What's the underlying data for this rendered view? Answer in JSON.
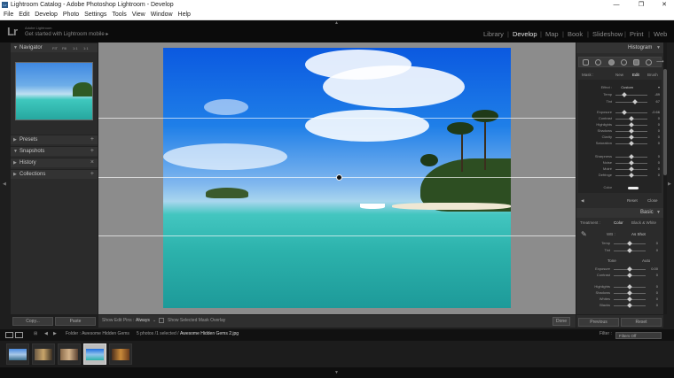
{
  "window": {
    "title": "Lightroom Catalog - Adobe Photoshop Lightroom - Develop",
    "app_icon": "Lr"
  },
  "menu": [
    "File",
    "Edit",
    "Develop",
    "Photo",
    "Settings",
    "Tools",
    "View",
    "Window",
    "Help"
  ],
  "identity": {
    "logo": "Lr",
    "brand_small": "Adobe Lightroom",
    "brand": "Get started with Lightroom mobile ▸"
  },
  "modules": [
    "Library",
    "Develop",
    "Map",
    "Book",
    "Slideshow",
    "Print",
    "Web"
  ],
  "active_module": "Develop",
  "left": {
    "navigator": {
      "title": "Navigator",
      "options": [
        "FIT",
        "Fill",
        "1:1",
        "1:1"
      ]
    },
    "panels": [
      "Presets",
      "Snapshots",
      "History",
      "Collections"
    ],
    "copy_label": "Copy...",
    "paste_label": "Paste"
  },
  "toolbar": {
    "overlay_label": "Show Edit Pins :",
    "overlay_value": "Always",
    "mask_label": "Show Selected Mask Overlay",
    "done_label": "Done"
  },
  "right": {
    "histogram_title": "Histogram",
    "mask_tabs": [
      "New",
      "Edit",
      "Brush"
    ],
    "mask_sliders": [
      {
        "label": "Effect :",
        "value": "Custom"
      },
      {
        "label": "Temp",
        "value": "-89"
      },
      {
        "label": "Tint",
        "value": "67"
      },
      {
        "label": "Exposure",
        "value": "-0.66"
      },
      {
        "label": "Contrast",
        "value": "0"
      },
      {
        "label": "Highlights",
        "value": "0"
      },
      {
        "label": "Shadows",
        "value": "0"
      },
      {
        "label": "Clarity",
        "value": "0"
      },
      {
        "label": "Saturation",
        "value": "0"
      },
      {
        "label": "Sharpness",
        "value": "0"
      },
      {
        "label": "Noise",
        "value": "0"
      },
      {
        "label": "Moiré",
        "value": "0"
      },
      {
        "label": "Defringe",
        "value": "0"
      },
      {
        "label": "Color",
        "value": ""
      }
    ],
    "reset_label": "Reset",
    "close_label": "Close",
    "basic_title": "Basic",
    "treatment_label": "Treatment :",
    "treatment_options": [
      "Color",
      "Black & White"
    ],
    "wb_label": "WB :",
    "wb_value": "As Shot",
    "basic_sliders": [
      {
        "label": "Temp",
        "value": "0"
      },
      {
        "label": "Tint",
        "value": "0"
      },
      {
        "label": "Exposure",
        "value": "0.00"
      },
      {
        "label": "Contrast",
        "value": "0"
      },
      {
        "label": "Highlights",
        "value": "0"
      },
      {
        "label": "Shadows",
        "value": "0"
      },
      {
        "label": "Whites",
        "value": "0"
      },
      {
        "label": "Blacks",
        "value": "0"
      }
    ],
    "tone_label": "Tone",
    "auto_label": "Auto",
    "previous_label": "Previous",
    "reset2_label": "Reset"
  },
  "filmstrip": {
    "source": "Folder : Awesome Hidden Gems",
    "counts": "5 photos /1 selected /",
    "filename": "Awesome Hidden Gems 2.jpg",
    "filter_label": "Filter :",
    "filter_value": "Filters Off"
  }
}
